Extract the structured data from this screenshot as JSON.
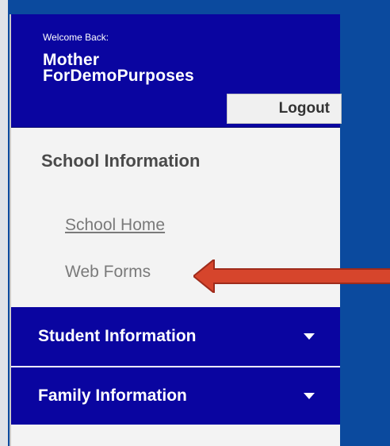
{
  "welcome": {
    "greeting": "Welcome Back:",
    "user_line1": "Mother",
    "user_line2": "ForDemoPurposes",
    "logout_label": "Logout"
  },
  "sidebar": {
    "section_title": "School Information",
    "links": [
      "School Home",
      "Web Forms"
    ],
    "accordions": [
      {
        "label": "Student Information",
        "icon": "chevron-down-icon"
      },
      {
        "label": "Family Information",
        "icon": "chevron-down-icon"
      }
    ]
  },
  "colors": {
    "background": "#0b4a9e",
    "nav_bar": "#0a05a0",
    "panel": "#f3f3f3",
    "arrow": "#d6452c"
  }
}
